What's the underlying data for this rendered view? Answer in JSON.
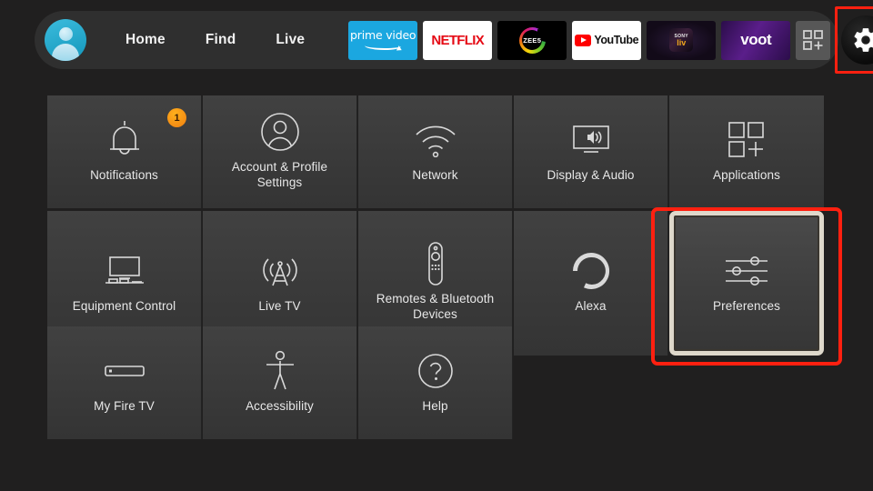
{
  "nav": {
    "avatar": "profile-avatar",
    "links": [
      {
        "label": "Home"
      },
      {
        "label": "Find"
      },
      {
        "label": "Live"
      }
    ],
    "apps": [
      {
        "name": "prime-video",
        "label": "prime video"
      },
      {
        "name": "netflix",
        "label": "NETFLIX"
      },
      {
        "name": "zee5",
        "label": "ZEE5"
      },
      {
        "name": "youtube",
        "label": "YouTube"
      },
      {
        "name": "sonyliv",
        "label": "SONY liv"
      },
      {
        "name": "voot",
        "label": "voot"
      },
      {
        "name": "app-library",
        "label": ""
      }
    ],
    "settings_button": {
      "name": "settings-gear",
      "has_notification_dot": true,
      "highlighted": true,
      "highlight_color": "#ff2010"
    }
  },
  "grid": {
    "rows": [
      [
        {
          "label": "Notifications",
          "icon": "bell-icon",
          "badge": "1"
        },
        {
          "label": "Account & Profile Settings",
          "icon": "person-icon",
          "badge": ""
        },
        {
          "label": "Network",
          "icon": "wifi-icon",
          "badge": ""
        },
        {
          "label": "Display & Audio",
          "icon": "tv-speaker-icon",
          "badge": ""
        },
        {
          "label": "Applications",
          "icon": "app-grid-plus-icon",
          "badge": ""
        }
      ],
      [
        {
          "label": "Equipment Control",
          "icon": "tv-stand-icon",
          "badge": ""
        },
        {
          "label": "Live TV",
          "icon": "broadcast-tower-icon",
          "badge": ""
        },
        {
          "label": "Remotes & Bluetooth Devices",
          "icon": "remote-control-icon",
          "badge": ""
        },
        {
          "label": "Alexa",
          "icon": "alexa-ring-icon",
          "badge": ""
        },
        {
          "label": "Preferences",
          "icon": "sliders-icon",
          "badge": "",
          "focused": true
        }
      ],
      [
        {
          "label": "My Fire TV",
          "icon": "fire-tv-stick-icon",
          "badge": ""
        },
        {
          "label": "Accessibility",
          "icon": "accessibility-person-icon",
          "badge": ""
        },
        {
          "label": "Help",
          "icon": "question-circle-icon",
          "badge": ""
        }
      ]
    ]
  },
  "colors": {
    "background": "#201f1f",
    "tile": "#3b3b3b",
    "topbar": "#2f2f2f",
    "accent_orange": "#ff9900",
    "highlight_red": "#ff2010",
    "focus_border": "#ded8cb",
    "text": "#e8e8e8"
  }
}
